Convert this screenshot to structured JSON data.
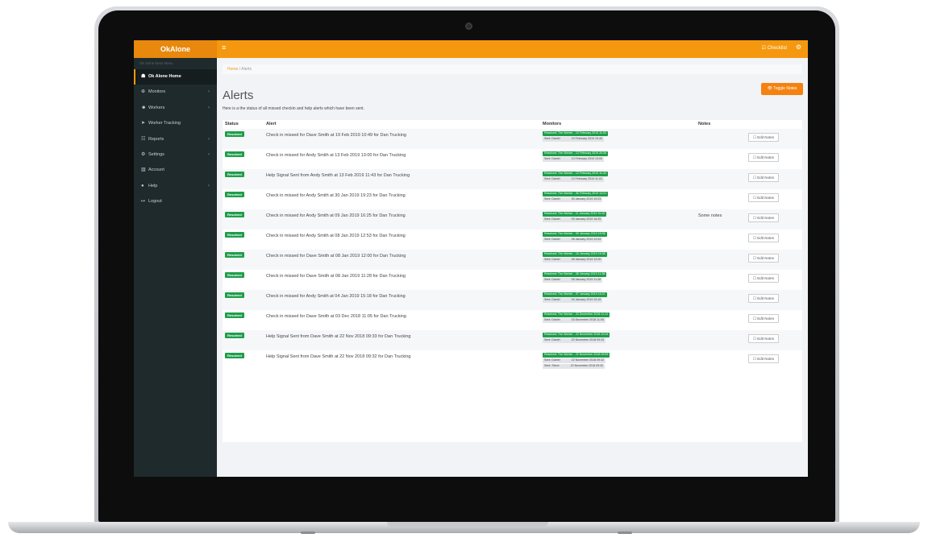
{
  "brand": "OkAlone",
  "topbar": {
    "hamburger": "≡",
    "checklist": "☑ Checklist",
    "gear": "⚙"
  },
  "sidebar": {
    "heading": "Ok Alone Main Menu",
    "items": [
      {
        "label": "Ok Alone Home",
        "icon": "☗",
        "chevron": "",
        "active": true
      },
      {
        "label": "Monitors",
        "icon": "⊕",
        "chevron": "‹",
        "active": false
      },
      {
        "label": "Workers",
        "icon": "☻",
        "chevron": "‹",
        "active": false
      },
      {
        "label": "Worker Tracking",
        "icon": "➤",
        "chevron": "",
        "active": false
      },
      {
        "label": "Reports",
        "icon": "☷",
        "chevron": "‹",
        "active": false
      },
      {
        "label": "Settings",
        "icon": "⚙",
        "chevron": "‹",
        "active": false
      },
      {
        "label": "Account",
        "icon": "▥",
        "chevron": "",
        "active": false
      },
      {
        "label": "Help",
        "icon": "●",
        "chevron": "‹",
        "active": false
      },
      {
        "label": "Logout",
        "icon": "↦",
        "chevron": "",
        "active": false
      }
    ]
  },
  "breadcrumb": {
    "home": "Home",
    "separator": " / ",
    "current": "Alerts"
  },
  "toggle_notes": "👁 Toggle Notes",
  "page": {
    "title": "Alerts",
    "description": "Here is a the status of all missed checkin and help alerts which have been sent."
  },
  "table": {
    "headers": {
      "status": "Status",
      "alert": "Alert",
      "monitors": "Monitors",
      "notes": "Notes"
    },
    "edit_label": "☐ Edit Notes",
    "rows": [
      {
        "status": "Resolved",
        "alert": "Check in missed for Dave Smith at 19 Feb 2019 10:49 for Dan Trucking",
        "resolved": "Resolved: The Worker - 19 February 2019 11:03",
        "sent": [
          [
            "Sent: Daniel",
            "19 February 2019 10:49"
          ]
        ],
        "notes": ""
      },
      {
        "status": "Resolved",
        "alert": "Check in missed for Andy Smith at 13 Feb 2019 13:00 for Dan Trucking",
        "resolved": "Resolved: The Worker - 13 February 2019 20:26",
        "sent": [
          [
            "Sent: Daniel",
            "13 February 2019 13:00"
          ]
        ],
        "notes": ""
      },
      {
        "status": "Resolved",
        "alert": "Help Signal Sent from Andy Smith at 13 Feb 2019 11:43 for Dan Trucking",
        "resolved": "Resolved: The Worker - 13 February 2019 11:44",
        "sent": [
          [
            "Sent: Daniel",
            "13 February 2019 11:43"
          ]
        ],
        "notes": ""
      },
      {
        "status": "Resolved",
        "alert": "Check in missed for Andy Smith at 30 Jan 2019 19:23 for Dan Trucking",
        "resolved": "Resolved: The Worker - 06 February 2019 13:21",
        "sent": [
          [
            "Sent: Daniel",
            "30 January 2019 19:23"
          ]
        ],
        "notes": ""
      },
      {
        "status": "Resolved",
        "alert": "Check in missed for Andy Smith at 09 Jan 2019 16:25 for Dan Trucking",
        "resolved": "Resolved: The Worker - 11 January 2019 11:19",
        "sent": [
          [
            "Sent: Daniel",
            "09 January 2019 16:25"
          ]
        ],
        "notes": "Some notes"
      },
      {
        "status": "Resolved",
        "alert": "Check in missed for Andy Smith at 08 Jan 2019 12:53 for Dan Trucking",
        "resolved": "Resolved: The Worker - 09 January 2019 15:06",
        "sent": [
          [
            "Sent: Daniel",
            "08 January 2019 12:53"
          ]
        ],
        "notes": ""
      },
      {
        "status": "Resolved",
        "alert": "Check in missed for Dave Smith at 08 Jan 2019 12:00 for Dan Trucking",
        "resolved": "Resolved: The Worker - 16 January 2019 16:38",
        "sent": [
          [
            "Sent: Daniel",
            "08 January 2019 12:00"
          ]
        ],
        "notes": ""
      },
      {
        "status": "Resolved",
        "alert": "Check in missed for Dave Smith at 08 Jan 2019 11:28 for Dan Trucking",
        "resolved": "Resolved: The Worker - 08 January 2019 11:38",
        "sent": [
          [
            "Sent: Daniel",
            "08 January 2019 11:28"
          ]
        ],
        "notes": ""
      },
      {
        "status": "Resolved",
        "alert": "Check in missed for Andy Smith at 04 Jan 2019 15:18 for Dan Trucking",
        "resolved": "Resolved: The Worker - 07 January 2019 16:37",
        "sent": [
          [
            "Sent: Daniel",
            "04 January 2019 15:18"
          ]
        ],
        "notes": ""
      },
      {
        "status": "Resolved",
        "alert": "Check in missed for Dave Smith at 03 Dec 2018 11:05 for Dan Trucking",
        "resolved": "Resolved: The Worker - 03 December 2018 11:12",
        "sent": [
          [
            "Sent: Daniel",
            "03 December 2018 11:05"
          ]
        ],
        "notes": ""
      },
      {
        "status": "Resolved",
        "alert": "Help Signal Sent from Dave Smith at 22 Nov 2018 09:33 for Dan Trucking",
        "resolved": "Resolved: The Worker - 22 November 2018 10:04",
        "sent": [
          [
            "Sent: Daniel",
            "22 November 2018 09:33"
          ]
        ],
        "notes": ""
      },
      {
        "status": "Resolved",
        "alert": "Help Signal Sent from Dave Smith at 22 Nov 2018 09:32 for Dan Trucking",
        "resolved": "Resolved: The Worker - 22 November 2018 09:53",
        "sent": [
          [
            "Sent: Daniel",
            "22 November 2018 09:32"
          ],
          [
            "Sent: Steve",
            "22 November 2018 09:32"
          ]
        ],
        "notes": ""
      }
    ]
  }
}
